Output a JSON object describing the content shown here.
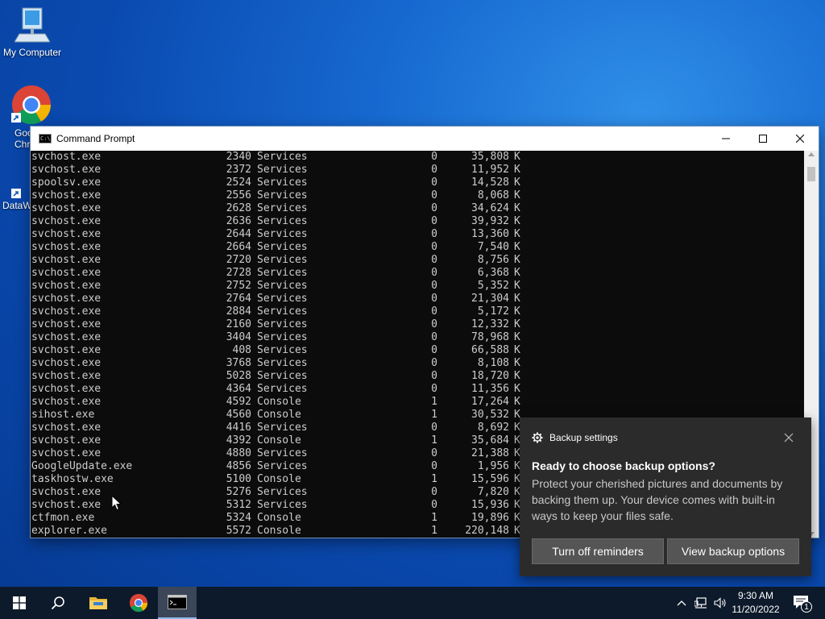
{
  "desktop": {
    "icons": [
      {
        "label": "My Computer"
      },
      {
        "label": "Goo\nChr"
      },
      {
        "label": "DataW"
      }
    ]
  },
  "cmd_window": {
    "title": "Command Prompt",
    "rows": [
      {
        "name": "svchost.exe",
        "pid": "2340",
        "session": "Services",
        "num": "0",
        "mem": "35,808",
        "unit": "K"
      },
      {
        "name": "svchost.exe",
        "pid": "2372",
        "session": "Services",
        "num": "0",
        "mem": "11,952",
        "unit": "K"
      },
      {
        "name": "spoolsv.exe",
        "pid": "2524",
        "session": "Services",
        "num": "0",
        "mem": "14,528",
        "unit": "K"
      },
      {
        "name": "svchost.exe",
        "pid": "2556",
        "session": "Services",
        "num": "0",
        "mem": "8,068",
        "unit": "K"
      },
      {
        "name": "svchost.exe",
        "pid": "2628",
        "session": "Services",
        "num": "0",
        "mem": "34,624",
        "unit": "K"
      },
      {
        "name": "svchost.exe",
        "pid": "2636",
        "session": "Services",
        "num": "0",
        "mem": "39,932",
        "unit": "K"
      },
      {
        "name": "svchost.exe",
        "pid": "2644",
        "session": "Services",
        "num": "0",
        "mem": "13,360",
        "unit": "K"
      },
      {
        "name": "svchost.exe",
        "pid": "2664",
        "session": "Services",
        "num": "0",
        "mem": "7,540",
        "unit": "K"
      },
      {
        "name": "svchost.exe",
        "pid": "2720",
        "session": "Services",
        "num": "0",
        "mem": "8,756",
        "unit": "K"
      },
      {
        "name": "svchost.exe",
        "pid": "2728",
        "session": "Services",
        "num": "0",
        "mem": "6,368",
        "unit": "K"
      },
      {
        "name": "svchost.exe",
        "pid": "2752",
        "session": "Services",
        "num": "0",
        "mem": "5,352",
        "unit": "K"
      },
      {
        "name": "svchost.exe",
        "pid": "2764",
        "session": "Services",
        "num": "0",
        "mem": "21,304",
        "unit": "K"
      },
      {
        "name": "svchost.exe",
        "pid": "2884",
        "session": "Services",
        "num": "0",
        "mem": "5,172",
        "unit": "K"
      },
      {
        "name": "svchost.exe",
        "pid": "2160",
        "session": "Services",
        "num": "0",
        "mem": "12,332",
        "unit": "K"
      },
      {
        "name": "svchost.exe",
        "pid": "3404",
        "session": "Services",
        "num": "0",
        "mem": "78,968",
        "unit": "K"
      },
      {
        "name": "svchost.exe",
        "pid": "408",
        "session": "Services",
        "num": "0",
        "mem": "66,588",
        "unit": "K"
      },
      {
        "name": "svchost.exe",
        "pid": "3768",
        "session": "Services",
        "num": "0",
        "mem": "8,108",
        "unit": "K"
      },
      {
        "name": "svchost.exe",
        "pid": "5028",
        "session": "Services",
        "num": "0",
        "mem": "18,720",
        "unit": "K"
      },
      {
        "name": "svchost.exe",
        "pid": "4364",
        "session": "Services",
        "num": "0",
        "mem": "11,356",
        "unit": "K"
      },
      {
        "name": "svchost.exe",
        "pid": "4592",
        "session": "Console",
        "num": "1",
        "mem": "17,264",
        "unit": "K"
      },
      {
        "name": "sihost.exe",
        "pid": "4560",
        "session": "Console",
        "num": "1",
        "mem": "30,532",
        "unit": "K"
      },
      {
        "name": "svchost.exe",
        "pid": "4416",
        "session": "Services",
        "num": "0",
        "mem": "8,692",
        "unit": "K"
      },
      {
        "name": "svchost.exe",
        "pid": "4392",
        "session": "Console",
        "num": "1",
        "mem": "35,684",
        "unit": "K"
      },
      {
        "name": "svchost.exe",
        "pid": "4880",
        "session": "Services",
        "num": "0",
        "mem": "21,388",
        "unit": "K"
      },
      {
        "name": "GoogleUpdate.exe",
        "pid": "4856",
        "session": "Services",
        "num": "0",
        "mem": "1,956",
        "unit": "K"
      },
      {
        "name": "taskhostw.exe",
        "pid": "5100",
        "session": "Console",
        "num": "1",
        "mem": "15,596",
        "unit": "K"
      },
      {
        "name": "svchost.exe",
        "pid": "5276",
        "session": "Services",
        "num": "0",
        "mem": "7,820",
        "unit": "K"
      },
      {
        "name": "svchost.exe",
        "pid": "5312",
        "session": "Services",
        "num": "0",
        "mem": "15,936",
        "unit": "K"
      },
      {
        "name": "ctfmon.exe",
        "pid": "5324",
        "session": "Console",
        "num": "1",
        "mem": "19,896",
        "unit": "K"
      },
      {
        "name": "explorer.exe",
        "pid": "5572",
        "session": "Console",
        "num": "1",
        "mem": "220,148",
        "unit": "K"
      }
    ]
  },
  "toast": {
    "app_name": "Backup settings",
    "title": "Ready to choose backup options?",
    "body": "Protect your cherished pictures and documents by backing them up. Your device comes with built-in ways to keep your files safe.",
    "button_turn_off": "Turn off reminders",
    "button_view": "View backup options"
  },
  "taskbar": {
    "time": "9:30 AM",
    "date": "11/20/2022",
    "notification_count": "1"
  },
  "colors": {
    "console_bg": "#0c0c0c",
    "console_text": "#cccccc",
    "toast_bg": "#2b2b2b",
    "taskbar_bg": "#0d1a2b"
  }
}
